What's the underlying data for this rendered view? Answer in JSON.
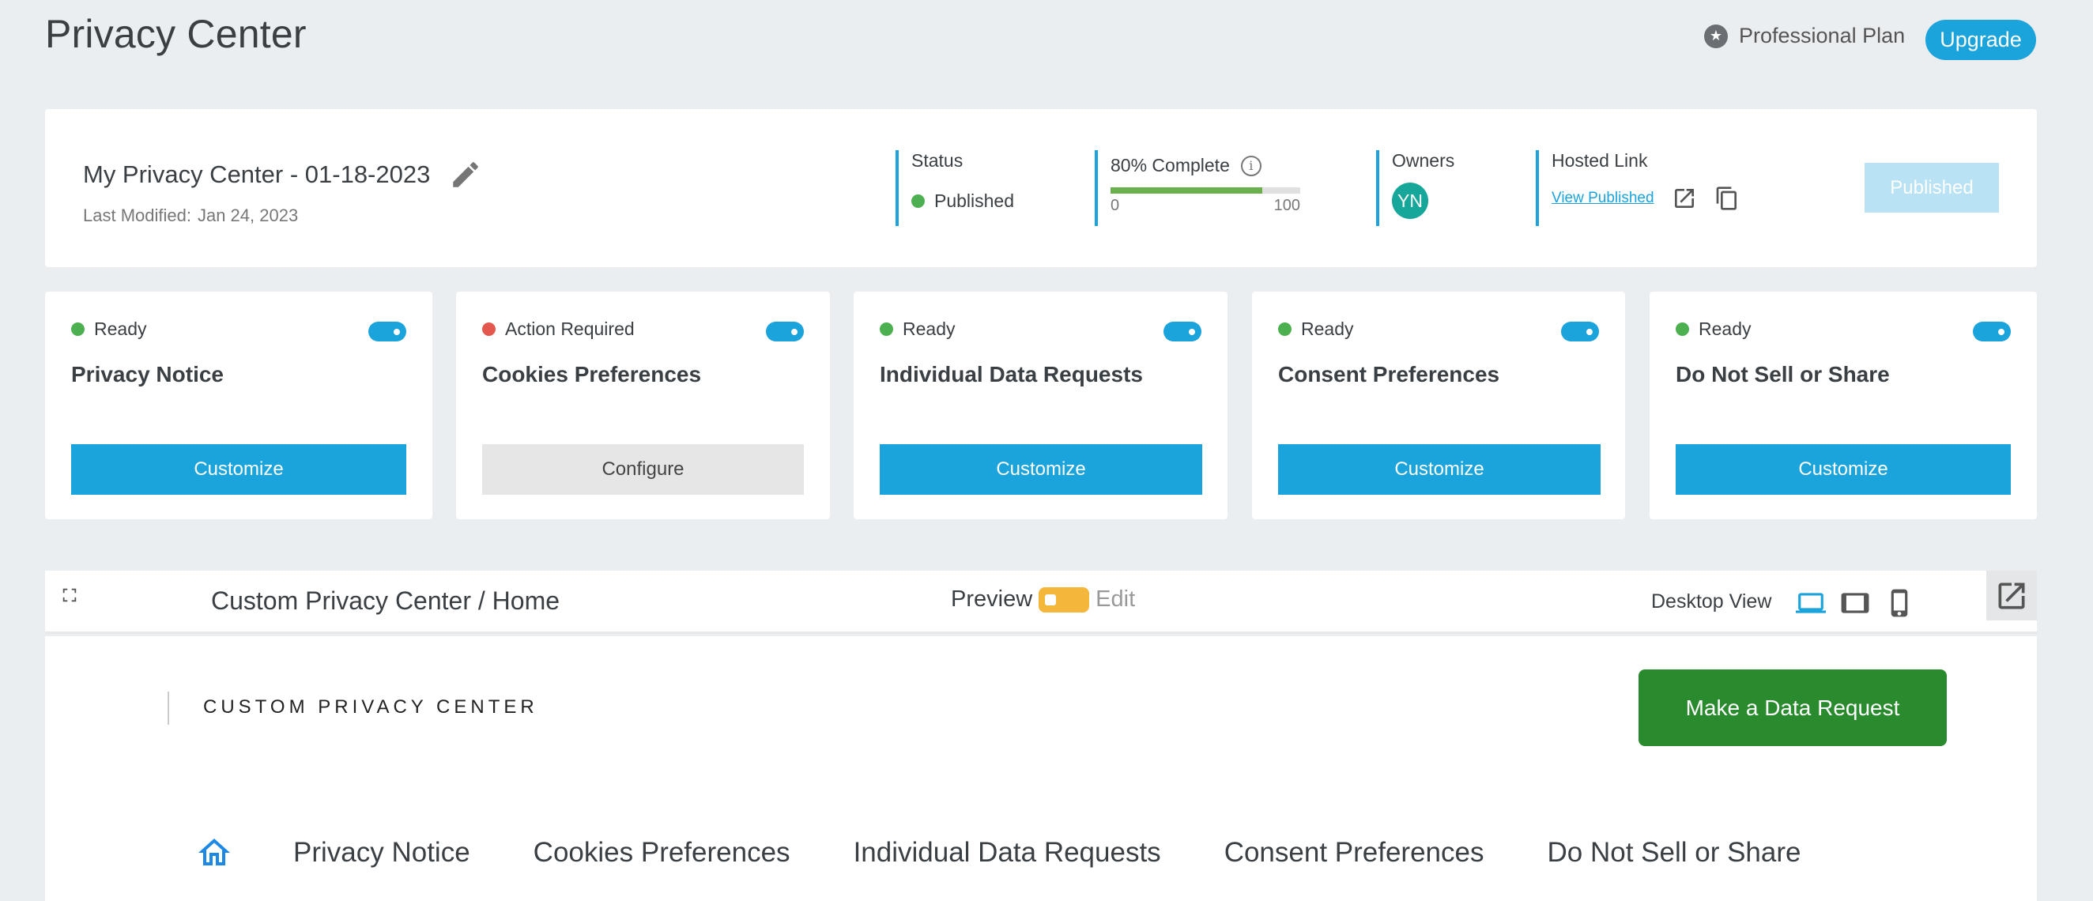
{
  "header": {
    "title": "Privacy Center",
    "plan_icon": "star-circle-icon",
    "plan_label": "Professional Plan",
    "upgrade_label": "Upgrade"
  },
  "summary": {
    "name": "My Privacy Center - 01-18-2023",
    "last_modified_label": "Last Modified:",
    "last_modified_value": "Jan 24, 2023",
    "status_label": "Status",
    "status_value": "Published",
    "progress_label": "80% Complete",
    "progress_value": 80,
    "progress_min": "0",
    "progress_max": "100",
    "owners_label": "Owners",
    "owner_initials": "YN",
    "hosted_label": "Hosted Link",
    "hosted_link_text": "View Published",
    "published_button": "Published"
  },
  "cards": [
    {
      "status": "Ready",
      "status_color": "#4caf50",
      "title": "Privacy Notice",
      "button": "Customize"
    },
    {
      "status": "Action Required",
      "status_color": "#e3574f",
      "title": "Cookies Preferences",
      "button": "Configure"
    },
    {
      "status": "Ready",
      "status_color": "#4caf50",
      "title": "Individual Data Requests",
      "button": "Customize"
    },
    {
      "status": "Ready",
      "status_color": "#4caf50",
      "title": "Consent Preferences",
      "button": "Customize"
    },
    {
      "status": "Ready",
      "status_color": "#4caf50",
      "title": "Do Not Sell or Share",
      "button": "Customize"
    }
  ],
  "preview": {
    "breadcrumb": "Custom Privacy Center / Home",
    "preview_label": "Preview",
    "edit_label": "Edit",
    "view_label": "Desktop View",
    "devices": [
      "laptop-icon",
      "tablet-icon",
      "phone-icon"
    ],
    "site_title": "CUSTOM PRIVACY CENTER",
    "request_button": "Make a Data Request",
    "nav": [
      "Privacy Notice",
      "Cookies Preferences",
      "Individual Data Requests",
      "Consent Preferences",
      "Do Not Sell or Share"
    ]
  },
  "colors": {
    "accent": "#1ba3dc",
    "request_button": "#2a8a2e",
    "toggle_edit": "#f5b73b"
  }
}
